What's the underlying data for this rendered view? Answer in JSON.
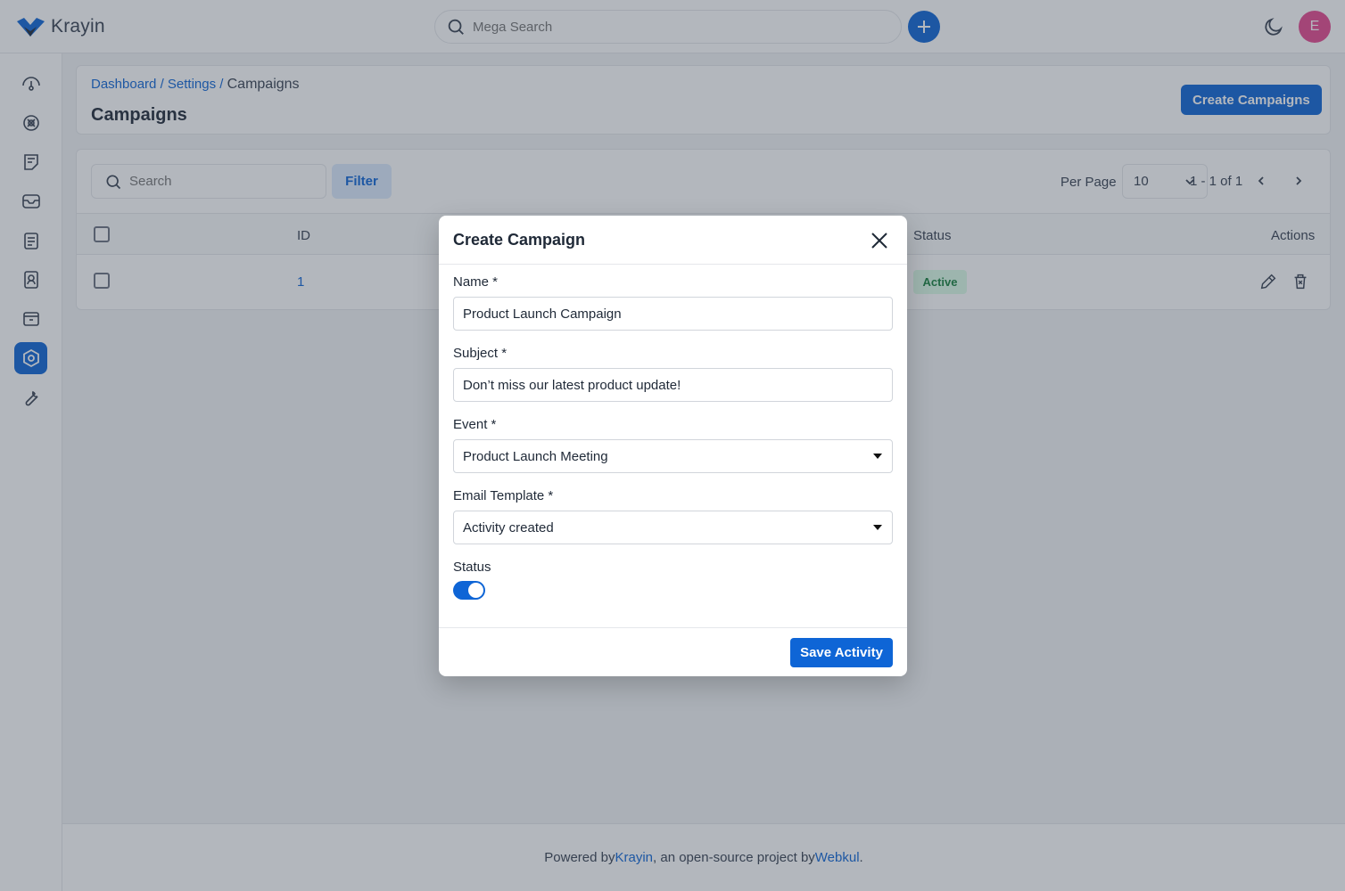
{
  "app": {
    "name": "Krayin"
  },
  "header": {
    "search_placeholder": "Mega Search",
    "user_initial": "E"
  },
  "sidebar": {
    "items": [
      {
        "icon": "dashboard-icon"
      },
      {
        "icon": "leads-icon"
      },
      {
        "icon": "quotes-icon"
      },
      {
        "icon": "mail-icon"
      },
      {
        "icon": "activities-icon"
      },
      {
        "icon": "contacts-icon"
      },
      {
        "icon": "products-icon"
      },
      {
        "icon": "settings-icon",
        "active": true
      },
      {
        "icon": "configuration-icon"
      }
    ]
  },
  "breadcrumb": {
    "dashboard": "Dashboard",
    "settings": "Settings",
    "current": "Campaigns",
    "sep": "/"
  },
  "page": {
    "title": "Campaigns",
    "create_label": "Create Campaigns"
  },
  "datagrid": {
    "search_placeholder": "Search",
    "filter_label": "Filter",
    "per_page_label": "Per Page",
    "per_page_value": "10",
    "pagination": "1 - 1 of 1",
    "columns": {
      "id": "ID",
      "status": "Status",
      "actions": "Actions"
    },
    "rows": [
      {
        "id": "1",
        "status": "Active"
      }
    ]
  },
  "modal": {
    "title": "Create Campaign",
    "name_label": "Name *",
    "name_value": "Product Launch Campaign",
    "subject_label": "Subject *",
    "subject_value": "Don’t miss our latest product update!",
    "event_label": "Event *",
    "event_value": "Product Launch Meeting",
    "template_label": "Email Template *",
    "template_value": "Activity created",
    "status_label": "Status",
    "status_on": true,
    "save_label": "Save Activity"
  },
  "footer": {
    "prefix": "Powered by ",
    "krayin": "Krayin",
    "middle": ", an open-source project by ",
    "webkul": "Webkul",
    "suffix": "."
  },
  "colors": {
    "primary": "#0e65d6",
    "active_badge_bg": "#dcfce7",
    "active_badge_text": "#15803d",
    "avatar": "#e5488f"
  }
}
